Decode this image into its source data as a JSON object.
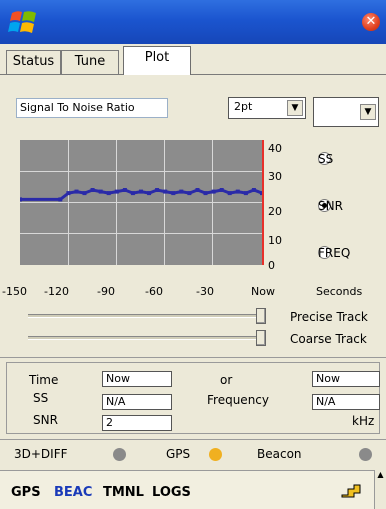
{
  "tabs": [
    "Status",
    "Tune",
    "Plot"
  ],
  "plot_title": "Signal To Noise Ratio",
  "points_select": "2pt",
  "second_select": "",
  "y_ticks": [
    "40",
    "30",
    "20",
    "10",
    "0"
  ],
  "x_ticks": [
    "-150",
    "-120",
    "-90",
    "-60",
    "-30",
    "Now"
  ],
  "x_unit": "Seconds",
  "radios": [
    {
      "label": "SS",
      "selected": false
    },
    {
      "label": "SNR",
      "selected": true
    },
    {
      "label": "FREQ",
      "selected": false
    }
  ],
  "sliders": [
    {
      "label": "Precise Track",
      "value": 1.0
    },
    {
      "label": "Coarse Track",
      "value": 1.0
    }
  ],
  "info": {
    "time_label": "Time",
    "time_value": "Now",
    "ss_label": "SS",
    "ss_value": "N/A",
    "snr_label": "SNR",
    "snr_value": "2",
    "or_label": "or",
    "right_time_value": "Now",
    "freq_label": "Frequency",
    "freq_value": "N/A",
    "khz_label": "kHz"
  },
  "indicators": {
    "mode_label": "3D+DIFF",
    "mode_color": "#8A8A8A",
    "gps_label": "GPS",
    "gps_color": "#F0B020",
    "beacon_label": "Beacon",
    "beacon_color": "#8A8A8A"
  },
  "statusbar": {
    "gps": "GPS",
    "beac": "BEAC",
    "tmnl": "TMNL",
    "logs": "LOGS"
  },
  "chart_data": {
    "type": "line",
    "title": "Signal To Noise Ratio",
    "xlabel": "Seconds",
    "ylabel": "",
    "xlim": [
      -150,
      0
    ],
    "ylim": [
      0,
      40
    ],
    "x_tick_labels": [
      "-150",
      "-120",
      "-90",
      "-60",
      "-30",
      "Now"
    ],
    "y_tick_labels": [
      "0",
      "10",
      "20",
      "30",
      "40"
    ],
    "grid": true,
    "series": [
      {
        "color": "#2A2AA8",
        "x": [
          -150,
          -125,
          -120,
          -115,
          -110,
          -105,
          -100,
          -95,
          -90,
          -85,
          -80,
          -75,
          -70,
          -65,
          -60,
          -55,
          -50,
          -45,
          -40,
          -35,
          -30,
          -25,
          -20,
          -15,
          -10,
          -5,
          0
        ],
        "y": [
          21,
          21,
          23,
          23.5,
          23,
          24,
          23.5,
          23,
          23.5,
          24,
          23,
          23.5,
          23,
          24,
          23.5,
          23,
          23.5,
          23,
          24,
          23,
          23.5,
          24,
          23,
          23.5,
          23,
          24,
          23
        ]
      }
    ]
  },
  "colors": {
    "title_bar": "#1B55CF",
    "plot_bg": "#8C8C8C",
    "now_line": "#E8302A",
    "beac_text": "#1A3AB8"
  }
}
